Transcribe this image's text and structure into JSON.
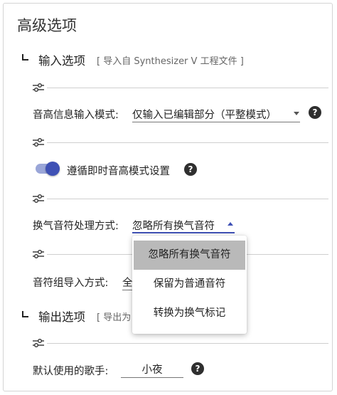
{
  "title": "高级选项",
  "input_section": {
    "label": "输入选项",
    "hint": "[ 导入自 Synthesizer V 工程文件 ]"
  },
  "pitch_mode": {
    "label": "音高信息输入模式:",
    "value": "仅输入已编辑部分（平整模式）"
  },
  "follow_toggle": {
    "label": "遵循即时音高模式设置",
    "checked": true
  },
  "breath_mode": {
    "label": "换气音符处理方式:",
    "value": "忽略所有换气音符"
  },
  "breath_menu": {
    "options": [
      "忽略所有换气音符",
      "保留为普通音符",
      "转换为换气标记"
    ],
    "selected_index": 0
  },
  "group_import": {
    "label": "音符组导入方式:",
    "value_visible": "全"
  },
  "output_section": {
    "label": "输出选项",
    "hint_visible": "[ 导出为"
  },
  "singer": {
    "label": "默认使用的歌手:",
    "value": "小夜"
  },
  "help_glyph": "?",
  "colors": {
    "accent": "#3f51b5",
    "toggle_track": "#9aa6d8",
    "menu_selected": "#b9b9b9"
  }
}
